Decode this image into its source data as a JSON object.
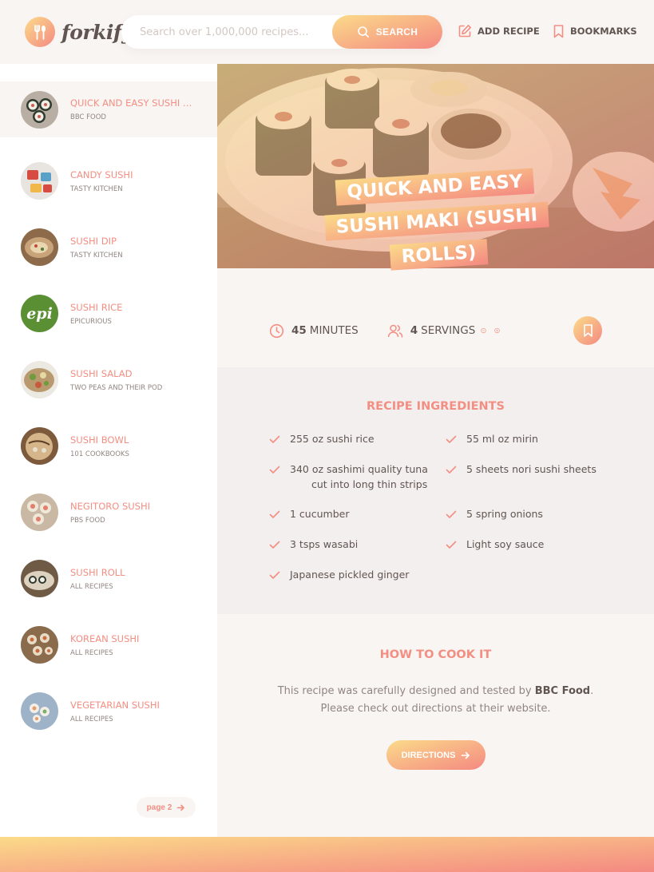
{
  "brand": {
    "name": "forkify"
  },
  "search": {
    "placeholder": "Search over 1,000,000 recipes...",
    "button_label": "SEARCH"
  },
  "nav": {
    "add_recipe": "ADD RECIPE",
    "bookmarks": "BOOKMARKS"
  },
  "results": [
    {
      "title": "QUICK AND EASY SUSHI MAKI (SUSHI ROLLS)",
      "publisher": "BBC FOOD",
      "active": true
    },
    {
      "title": "CANDY SUSHI",
      "publisher": "TASTY KITCHEN"
    },
    {
      "title": "SUSHI DIP",
      "publisher": "TASTY KITCHEN"
    },
    {
      "title": "SUSHI RICE",
      "publisher": "EPICURIOUS",
      "logo_text": "epi"
    },
    {
      "title": "SUSHI SALAD",
      "publisher": "TWO PEAS AND THEIR POD"
    },
    {
      "title": "SUSHI BOWL",
      "publisher": "101 COOKBOOKS"
    },
    {
      "title": "NEGITORO SUSHI",
      "publisher": "PBS FOOD"
    },
    {
      "title": "SUSHI ROLL",
      "publisher": "ALL RECIPES"
    },
    {
      "title": "KOREAN SUSHI",
      "publisher": "ALL RECIPES"
    },
    {
      "title": "VEGETARIAN SUSHI",
      "publisher": "ALL RECIPES"
    }
  ],
  "pagination": {
    "next_label": "page 2"
  },
  "recipe": {
    "title_lines": [
      "QUICK AND EASY",
      "SUSHI MAKI (SUSHI",
      "ROLLS)"
    ],
    "minutes": "45",
    "minutes_label": "MINUTES",
    "servings": "4",
    "servings_label": "SERVINGS",
    "ingredients_heading": "RECIPE INGREDIENTS",
    "ingredients_left": [
      [
        "255 oz sushi rice"
      ],
      [
        "340 oz sashimi quality tuna",
        "cut into long thin strips"
      ],
      [
        "1 cucumber"
      ],
      [
        "3 tsps wasabi"
      ],
      [
        " Japanese pickled ginger"
      ]
    ],
    "ingredients_right": [
      [
        "55 ml oz mirin"
      ],
      [
        "5 sheets nori sushi sheets"
      ],
      [
        "5 spring onions"
      ],
      [
        " Light soy sauce"
      ]
    ],
    "cook_heading": "HOW TO COOK IT",
    "cook_text_1": "This recipe was carefully designed and tested by ",
    "cook_publisher": "BBC Food",
    "cook_text_2": ".",
    "cook_text_3": "Please check out directions at their website.",
    "directions_label": "DIRECTIONS"
  },
  "colors": {
    "accent": "#f38e82",
    "gradient_start": "#fbdb89",
    "gradient_end": "#f48982",
    "background": "#f9f5f3",
    "ingredients_bg": "#f2efee",
    "text": "#615551"
  }
}
